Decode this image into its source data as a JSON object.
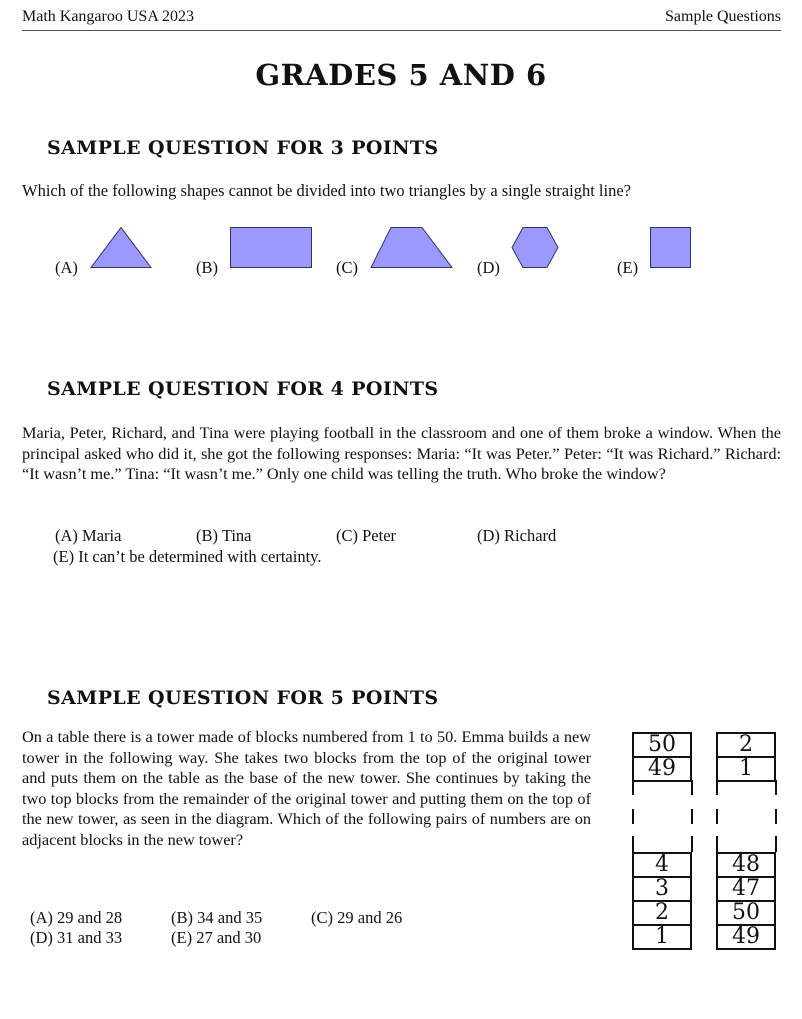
{
  "header": {
    "left": "Math Kangaroo USA 2023",
    "right": "Sample Questions"
  },
  "title": "GRADES 5 AND 6",
  "questions": [
    {
      "heading": "SAMPLE QUESTION FOR 3 POINTS",
      "text": "Which of the following shapes cannot be divided into two triangles by a single straight line?",
      "options": [
        {
          "label": "(A)",
          "shape": "triangle"
        },
        {
          "label": "(B)",
          "shape": "rectangle"
        },
        {
          "label": "(C)",
          "shape": "trapezoid"
        },
        {
          "label": "(D)",
          "shape": "hexagon"
        },
        {
          "label": "(E)",
          "shape": "square"
        }
      ],
      "shape_color": "#9999ff"
    },
    {
      "heading": "SAMPLE QUESTION FOR 4 POINTS",
      "text": "Maria, Peter, Richard, and Tina were playing football in the classroom and one of them broke a window. When the principal asked who did it, she got the following responses: Maria: “It was Peter.” Peter: “It was Richard.” Richard: “It wasn’t me.” Tina: “It wasn’t me.” Only one child was telling the truth. Who broke the window?",
      "options": [
        {
          "label": "(A) Maria"
        },
        {
          "label": "(B) Tina"
        },
        {
          "label": "(C) Peter"
        },
        {
          "label": "(D) Richard"
        },
        {
          "label": "(E) It can’t be determined with certainty."
        }
      ]
    },
    {
      "heading": "SAMPLE QUESTION FOR 5 POINTS",
      "text": "On a table there is a tower made of blocks numbered from 1 to 50. Emma builds a new tower in the following way. She takes two blocks from the top of the original tower and puts them on the table as the base of the new tower. She continues by taking the two top blocks from the remainder of the original tower and putting them on the top of the new tower, as seen in the diagram. Which of the following pairs of numbers are on adjacent blocks in the new tower?",
      "options": [
        {
          "label": "(A) 29 and 28"
        },
        {
          "label": "(B) 34 and 35"
        },
        {
          "label": "(C) 29 and 26"
        },
        {
          "label": "(D) 31 and 33"
        },
        {
          "label": "(E) 27 and 30"
        }
      ],
      "diagram": {
        "original_tower": {
          "top": [
            "50",
            "49"
          ],
          "bottom": [
            "4",
            "3",
            "2",
            "1"
          ]
        },
        "new_tower": {
          "top": [
            "2",
            "1"
          ],
          "bottom": [
            "48",
            "47",
            "50",
            "49"
          ]
        }
      }
    }
  ]
}
